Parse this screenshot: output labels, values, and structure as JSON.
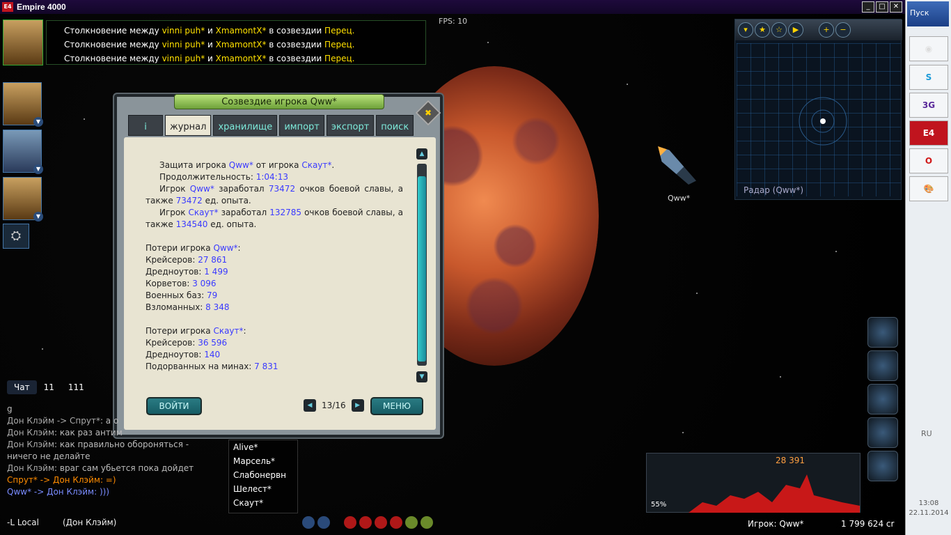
{
  "window": {
    "title": "Empire 4000",
    "logo": "E4"
  },
  "fps": "FPS: 10",
  "news": [
    {
      "pre": "Столкновение между ",
      "p1": "vinni puh*",
      "mid": " и ",
      "p2": "XmamontX*",
      "post": " в созвездии ",
      "place": "Перец."
    },
    {
      "pre": "Столкновение между ",
      "p1": "vinni puh*",
      "mid": " и ",
      "p2": "XmamontX*",
      "post": " в созвездии ",
      "place": "Перец."
    },
    {
      "pre": "Столкновение между ",
      "p1": "vinni puh*",
      "mid": " и ",
      "p2": "XmamontX*",
      "post": " в созвездии ",
      "place": "Перец."
    }
  ],
  "dialog": {
    "title": "Созвездие игрока Qww*",
    "close_icon": "close-icon",
    "tabs": [
      "i",
      "журнал",
      "хранилище",
      "импорт",
      "экспорт",
      "поиск"
    ],
    "active_tab": "журнал",
    "login_button": "ВОЙТИ",
    "menu_button": "МЕНЮ",
    "page": "13/16",
    "journal": {
      "l1a": "Защита игрока ",
      "l1b": "Qww*",
      "l1c": " от игрока ",
      "l1d": "Скаут*",
      "l1e": ".",
      "l2a": "Продолжительность: ",
      "l2b": "1:04:13",
      "l3a": "Игрок ",
      "l3b": "Qww*",
      "l3c": " заработал ",
      "l3d": "73472",
      "l3e": " очков боевой славы, а также ",
      "l3f": "73472",
      "l3g": " ед. опыта.",
      "l4a": "Игрок ",
      "l4b": "Скаут*",
      "l4c": " заработал ",
      "l4d": "132785",
      "l4e": " очков боевой славы, а также ",
      "l4f": "134540",
      "l4g": " ед. опыта.",
      "loss1_title_a": "Потери игрока ",
      "loss1_title_b": "Qww*",
      "loss1_title_c": ":",
      "loss1": [
        {
          "k": "Крейсеров: ",
          "v": "27 861"
        },
        {
          "k": "Дредноутов: ",
          "v": "1 499"
        },
        {
          "k": "Корветов: ",
          "v": "3 096"
        },
        {
          "k": "Военных баз: ",
          "v": "79"
        },
        {
          "k": "Взломанных: ",
          "v": "8 348"
        }
      ],
      "loss2_title_a": "Потери игрока ",
      "loss2_title_b": "Скаут*",
      "loss2_title_c": ":",
      "loss2": [
        {
          "k": "Крейсеров: ",
          "v": "36 596"
        },
        {
          "k": "Дредноутов: ",
          "v": "140"
        },
        {
          "k": "Подорванных на минах: ",
          "v": "7 831"
        }
      ]
    }
  },
  "chat": {
    "tabs": [
      "Чат",
      "11",
      "111"
    ],
    "lines": [
      {
        "a": "g",
        "b": ""
      },
      {
        "a": "Дон Клэйм -> Спрут*",
        "b": ": а о"
      },
      {
        "a": "Дон Клэйм",
        "b": ": как раз антим"
      },
      {
        "a": "Дон Клэйм",
        "b": ": как правильно обороняться - ничего не делайте"
      },
      {
        "a": "Дон Клэйм",
        "b": ": враг сам убьется пока дойдет"
      },
      {
        "a": "Спрут* -> Дон Клэйм",
        "b": ": =)"
      },
      {
        "a": "Qww* -> Дон Клэйм",
        "b": ": )))"
      }
    ],
    "channel": "-L Local",
    "nick": "(Дон Клэйм)"
  },
  "players": [
    "Alive*",
    "Марсель*",
    "Слабонервн",
    "Шелест*",
    "Скаут*"
  ],
  "radar": {
    "label": "Радар (Qww*)"
  },
  "ship_label": "Qww*",
  "fleet": {
    "count": "28 391",
    "percent": "55%"
  },
  "status": {
    "player": "Игрок: Qww*",
    "credits": "1 799 624 cr"
  },
  "taskbar": {
    "start": "Пуск",
    "icons": [
      "S",
      "3G",
      "E4",
      "O",
      ""
    ],
    "lang": "RU",
    "time": "13:08",
    "date": "22.11.2014"
  }
}
